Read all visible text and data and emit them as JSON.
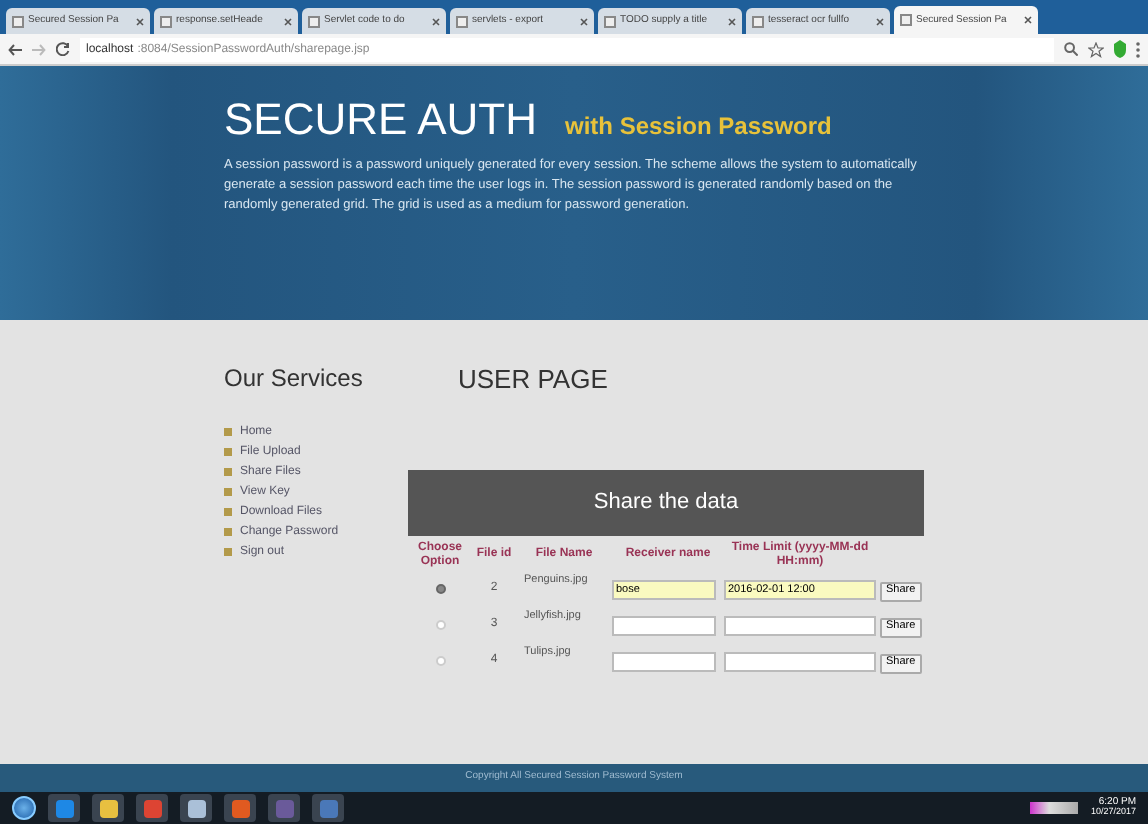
{
  "browser": {
    "tabs": [
      {
        "title": "Secured Session Pa",
        "selected": false
      },
      {
        "title": "response.setHeade",
        "selected": false
      },
      {
        "title": "Servlet code to do",
        "selected": false
      },
      {
        "title": "servlets - export",
        "selected": false
      },
      {
        "title": "TODO supply a title",
        "selected": false
      },
      {
        "title": "tesseract ocr fullfo",
        "selected": false
      },
      {
        "title": "Secured Session Pa",
        "selected": true
      }
    ],
    "address": {
      "host": "localhost",
      "rest": ":8084/SessionPasswordAuth/sharepage.jsp"
    }
  },
  "header": {
    "title": "SECURE AUTH",
    "subtitle": "with Session Password",
    "description": "A session password is a password uniquely generated for every session. The scheme allows the system to automatically generate a session password each time the user logs in. The session password is generated randomly based on the randomly generated grid. The grid is used as a medium for password generation."
  },
  "sidebar": {
    "title": "Our Services",
    "items": [
      "Home",
      "File Upload",
      "Share Files",
      "View Key",
      "Download Files",
      "Change Password",
      "Sign out"
    ]
  },
  "main": {
    "title": "USER PAGE",
    "panel_title": "Share the data",
    "columns": [
      "Choose Option",
      "File id",
      "File Name",
      "Receiver name",
      "Time Limit (yyyy-MM-dd HH:mm)"
    ],
    "rows": [
      {
        "selected": true,
        "id": "2",
        "name": "Penguins.jpg",
        "receiver": "bose",
        "time": "2016-02-01 12:00",
        "autofilled": true,
        "button": "Share"
      },
      {
        "selected": false,
        "id": "3",
        "name": "Jellyfish.jpg",
        "receiver": "",
        "time": "",
        "autofilled": false,
        "button": "Share"
      },
      {
        "selected": false,
        "id": "4",
        "name": "Tulips.jpg",
        "receiver": "",
        "time": "",
        "autofilled": false,
        "button": "Share"
      }
    ]
  },
  "footer": "Copyright All Secured Session Password System",
  "taskbar": {
    "time": "6:20 PM",
    "date": "10/27/2017"
  }
}
